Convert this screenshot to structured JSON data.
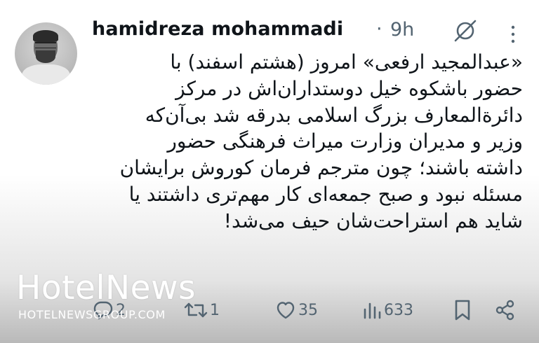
{
  "tweet": {
    "author_name": "hamidreza mohammadi",
    "separator": "·",
    "time": "9h",
    "body_lines": [
      "«عبدالمجید ارفعی» امروز (هشتم اسفند) با",
      "حضور باشکوه خیل دوستداران‌اش در مرکز",
      "دائرةالمعارف بزرگ اسلامی بدرقه شد بی‌آن‌که",
      "وزیر و مدیران وزارت میراث فرهنگی حضور",
      "داشته باشند؛ چون مترجم فرمان کوروش برایشان",
      "مسئله نبود و صبح جمعه‌ای کار مهم‌تری داشتند یا",
      "شاید هم استراحت‌شان حیف می‌شد!"
    ]
  },
  "actions": {
    "reply_count": "2",
    "retweet_count": "1",
    "like_count": "35",
    "views_count": "633"
  },
  "watermark": {
    "title": "HotelNews",
    "url": "HOTELNEWSGROUP.COM"
  },
  "icons": [
    "avatar",
    "grok-icon",
    "more-icon",
    "reply-icon",
    "retweet-icon",
    "like-icon",
    "views-icon",
    "bookmark-icon",
    "share-icon"
  ]
}
